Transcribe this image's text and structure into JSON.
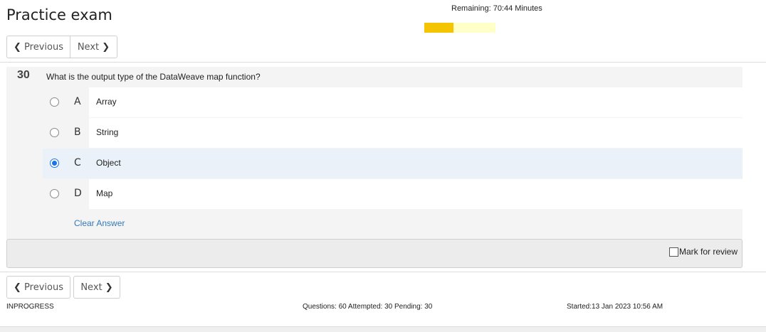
{
  "header": {
    "title": "Practice exam",
    "remaining": "Remaining: 70:44 Minutes",
    "time_progress": 0.41,
    "progress_colors": {
      "fill": "#f5c400",
      "track": "#ffffc8"
    }
  },
  "nav": {
    "previous_label": "Previous",
    "next_label": "Next",
    "previous_icon": "chevron-left-icon",
    "next_icon": "chevron-right-icon"
  },
  "question": {
    "number": "30",
    "text": "What is the output type of the DataWeave map function?",
    "options": [
      {
        "letter": "A",
        "text": "Array",
        "selected": false
      },
      {
        "letter": "B",
        "text": "String",
        "selected": false
      },
      {
        "letter": "C",
        "text": "Object",
        "selected": true
      },
      {
        "letter": "D",
        "text": "Map",
        "selected": false
      }
    ],
    "clear_label": "Clear Answer"
  },
  "review": {
    "label": "Mark for review",
    "checked": false
  },
  "footer": {
    "status": "INPROGRESS",
    "counts": "Questions: 60 Attempted: 30 Pending: 30",
    "started": "Started:13 Jan 2023 10:56 AM"
  },
  "colors": {
    "accent": "#337ab7",
    "selected_bg": "#eaf1f8",
    "radio": "#1a73e8"
  }
}
